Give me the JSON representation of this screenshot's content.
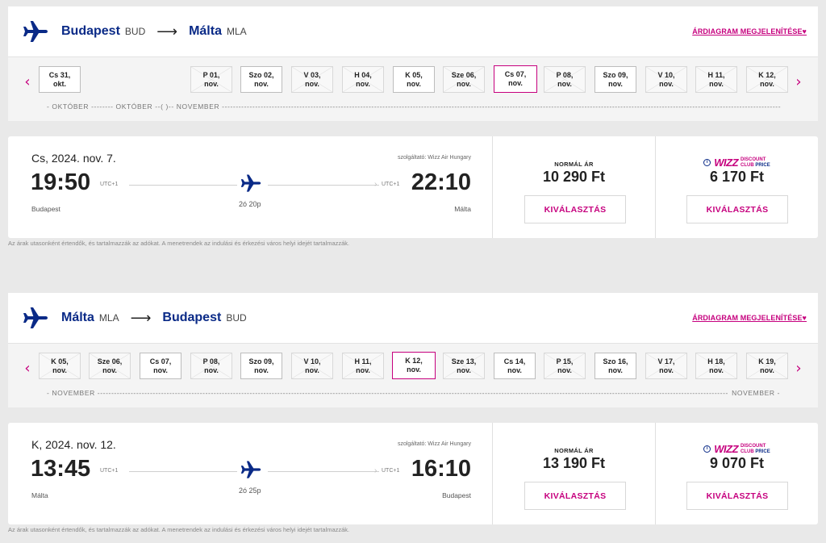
{
  "common": {
    "chart_link": "ÁRDIAGRAM MEGJELENÍTÉSE",
    "chart_link_heart": "♥",
    "route_arrow": "⟶",
    "nav_prev": "‹",
    "nav_next": "›",
    "select_label": "KIVÁLASZTÁS",
    "normal_price_label": "NORMÁL ÁR",
    "club_badge": {
      "brand": "WIZZ",
      "line1": "DISCOUNT",
      "line2": "CLUB",
      "line3": "PRICE",
      "info": "i"
    },
    "disclaimer": "Az árak utasonként értendők, és tartalmazzák az adókat. A menetrendek az indulási és érkezési város helyi idejét tartalmazzák.",
    "icons": {
      "route": "plane-icon",
      "flight": "plane-icon",
      "prev": "chevron-left-icon",
      "next": "chevron-right-icon"
    },
    "colors": {
      "brand_pink": "#c6007e",
      "brand_blue": "#0a2a87",
      "background": "#e9e9e9"
    }
  },
  "outbound": {
    "from_city": "Budapest",
    "from_code": "BUD",
    "to_city": "Málta",
    "to_code": "MLA",
    "months": {
      "left": "- OKTÓBER -------- OKTÓBER --( )-- NOVEMBER ---------------------------------------------------------------------------------------------------------------------------------------------------------------------------------------------------------------------------------------------------------------------------------------------------------------------",
      "right": ""
    },
    "dates": [
      {
        "day": "Cs 31,",
        "month": "okt.",
        "state": "available"
      },
      {
        "day": "P 01,",
        "month": "nov.",
        "state": "disabled"
      },
      {
        "day": "Szo 02,",
        "month": "nov.",
        "state": "available"
      },
      {
        "day": "V 03,",
        "month": "nov.",
        "state": "disabled"
      },
      {
        "day": "H 04,",
        "month": "nov.",
        "state": "disabled"
      },
      {
        "day": "K 05,",
        "month": "nov.",
        "state": "available"
      },
      {
        "day": "Sze 06,",
        "month": "nov.",
        "state": "disabled"
      },
      {
        "day": "Cs 07,",
        "month": "nov.",
        "state": "selected"
      },
      {
        "day": "P 08,",
        "month": "nov.",
        "state": "disabled"
      },
      {
        "day": "Szo 09,",
        "month": "nov.",
        "state": "available"
      },
      {
        "day": "V 10,",
        "month": "nov.",
        "state": "disabled"
      },
      {
        "day": "H 11,",
        "month": "nov.",
        "state": "disabled"
      },
      {
        "day": "K 12,",
        "month": "nov.",
        "state": "disabled"
      }
    ],
    "flight": {
      "date": "Cs, 2024. nov. 7.",
      "operator": "szolgáltató: Wizz Air Hungary",
      "dep_time": "19:50",
      "arr_time": "22:10",
      "dep_utc": "UTC+1",
      "arr_utc": "UTC+1",
      "duration": "2ó 20p",
      "dep_city": "Budapest",
      "arr_city": "Málta",
      "normal_price": "10 290 Ft",
      "club_price": "6 170 Ft"
    }
  },
  "return": {
    "from_city": "Málta",
    "from_code": "MLA",
    "to_city": "Budapest",
    "to_code": "BUD",
    "months": {
      "left": "- NOVEMBER -------------------------------------------------------------------------------------------------------------------------------------------------------------------------------------------------------------------------------------------------------------------------------------------",
      "right": "NOVEMBER -"
    },
    "dates": [
      {
        "day": "K 05,",
        "month": "nov.",
        "state": "disabled"
      },
      {
        "day": "Sze 06,",
        "month": "nov.",
        "state": "disabled"
      },
      {
        "day": "Cs 07,",
        "month": "nov.",
        "state": "available"
      },
      {
        "day": "P 08,",
        "month": "nov.",
        "state": "disabled"
      },
      {
        "day": "Szo 09,",
        "month": "nov.",
        "state": "available"
      },
      {
        "day": "V 10,",
        "month": "nov.",
        "state": "disabled"
      },
      {
        "day": "H 11,",
        "month": "nov.",
        "state": "disabled"
      },
      {
        "day": "K 12,",
        "month": "nov.",
        "state": "selected"
      },
      {
        "day": "Sze 13,",
        "month": "nov.",
        "state": "disabled"
      },
      {
        "day": "Cs 14,",
        "month": "nov.",
        "state": "available"
      },
      {
        "day": "P 15,",
        "month": "nov.",
        "state": "disabled"
      },
      {
        "day": "Szo 16,",
        "month": "nov.",
        "state": "available"
      },
      {
        "day": "V 17,",
        "month": "nov.",
        "state": "disabled"
      },
      {
        "day": "H 18,",
        "month": "nov.",
        "state": "disabled"
      },
      {
        "day": "K 19,",
        "month": "nov.",
        "state": "disabled"
      }
    ],
    "flight": {
      "date": "K, 2024. nov. 12.",
      "operator": "szolgáltató: Wizz Air Hungary",
      "dep_time": "13:45",
      "arr_time": "16:10",
      "dep_utc": "UTC+1",
      "arr_utc": "UTC+1",
      "duration": "2ó 25p",
      "dep_city": "Málta",
      "arr_city": "Budapest",
      "normal_price": "13 190 Ft",
      "club_price": "9 070 Ft"
    }
  }
}
